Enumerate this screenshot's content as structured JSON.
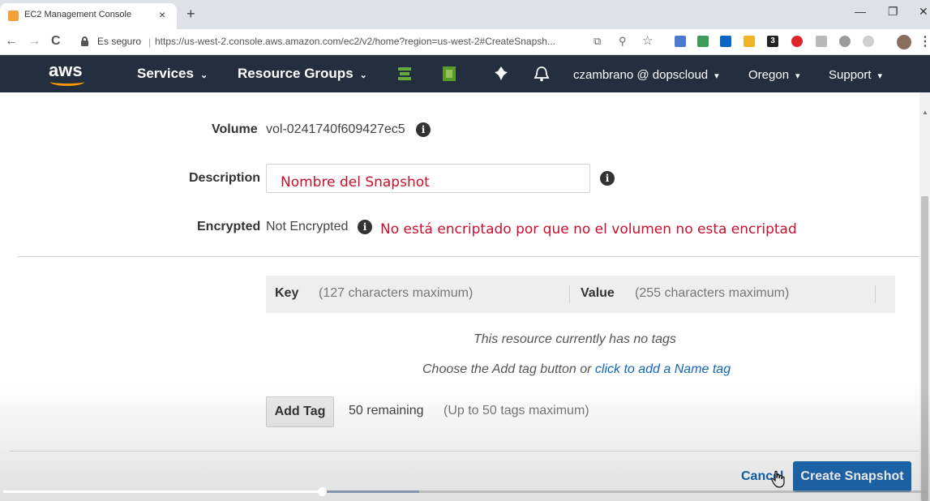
{
  "browser": {
    "tab_title": "EC2 Management Console",
    "tab_close": "×",
    "new_tab": "+",
    "minimize": "—",
    "restore": "❐",
    "close": "✕",
    "back": "←",
    "forward": "→",
    "reload": "C",
    "secure_label": "Es seguro",
    "separator": "|",
    "url": "https://us-west-2.console.aws.amazon.com/ec2/v2/home?region=us-west-2#CreateSnapsh...",
    "bookmark_star": "☆",
    "zoom_icon": "⚲",
    "translate_icon": "⧉",
    "extension_badge": "3"
  },
  "aws_nav": {
    "logo_text": "aws",
    "services": "Services",
    "resource_groups": "Resource Groups",
    "account": "czambrano @ dopscloud",
    "region": "Oregon",
    "support": "Support",
    "caret": "⌄",
    "caret_filled": "▾",
    "pin_glyph": "📌",
    "bell_glyph": "🔔"
  },
  "form": {
    "volume_label": "Volume",
    "volume_value": "vol-0241740f609427ec5",
    "description_label": "Description",
    "description_value": "",
    "encrypted_label": "Encrypted",
    "encrypted_value": "Not Encrypted",
    "info_glyph": "i"
  },
  "annotations": {
    "description_note": "Nombre del Snapshot",
    "encrypted_note": "No está encriptado por que no el volumen no esta encriptad"
  },
  "tags": {
    "key_label": "Key",
    "key_hint": "(127 characters maximum)",
    "value_label": "Value",
    "value_hint": "(255 characters maximum)",
    "empty_message": "This resource currently has no tags",
    "choose_prefix": "Choose the Add tag button or",
    "add_name_link": "click to add a Name tag",
    "add_tag_button": "Add Tag",
    "remaining": "50 remaining",
    "limit": "(Up to 50 tags maximum)"
  },
  "footer": {
    "cancel": "Cancel",
    "create": "Create Snapshot"
  },
  "video": {
    "played_fraction": 0.345,
    "buffered_fraction": 0.45
  },
  "colors": {
    "aws_nav_bg": "#232f3e",
    "aws_orange": "#ff9900",
    "primary_button": "#1f6bb5",
    "link": "#1166bb",
    "annotation": "#c8102e"
  }
}
